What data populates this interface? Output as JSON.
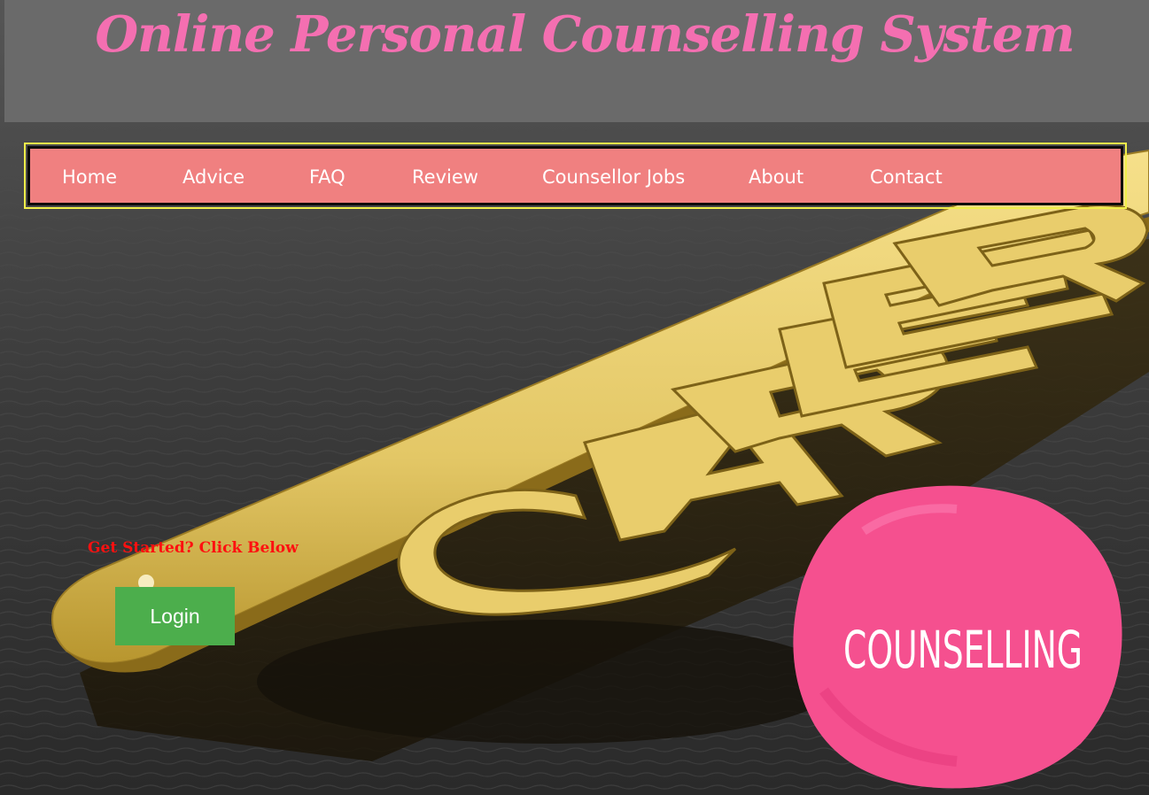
{
  "header": {
    "title": "Online Personal Counselling System"
  },
  "nav": {
    "items": [
      {
        "label": "Home"
      },
      {
        "label": "Advice"
      },
      {
        "label": "FAQ"
      },
      {
        "label": "Review"
      },
      {
        "label": "Counsellor Jobs"
      },
      {
        "label": "About"
      },
      {
        "label": "Contact"
      }
    ]
  },
  "hero": {
    "prompt": "Get Started? Click Below",
    "login_label": "Login",
    "key_word": "CAREER",
    "badge_text": "COUNSELLING"
  },
  "colors": {
    "title": "#f46fb1",
    "nav_bg": "#f08080",
    "nav_border": "#f2f04a",
    "login_bg": "#4cae4c",
    "prompt": "#ff1010",
    "key_gold": "#e8cf6f",
    "badge_pink": "#f5508f"
  }
}
